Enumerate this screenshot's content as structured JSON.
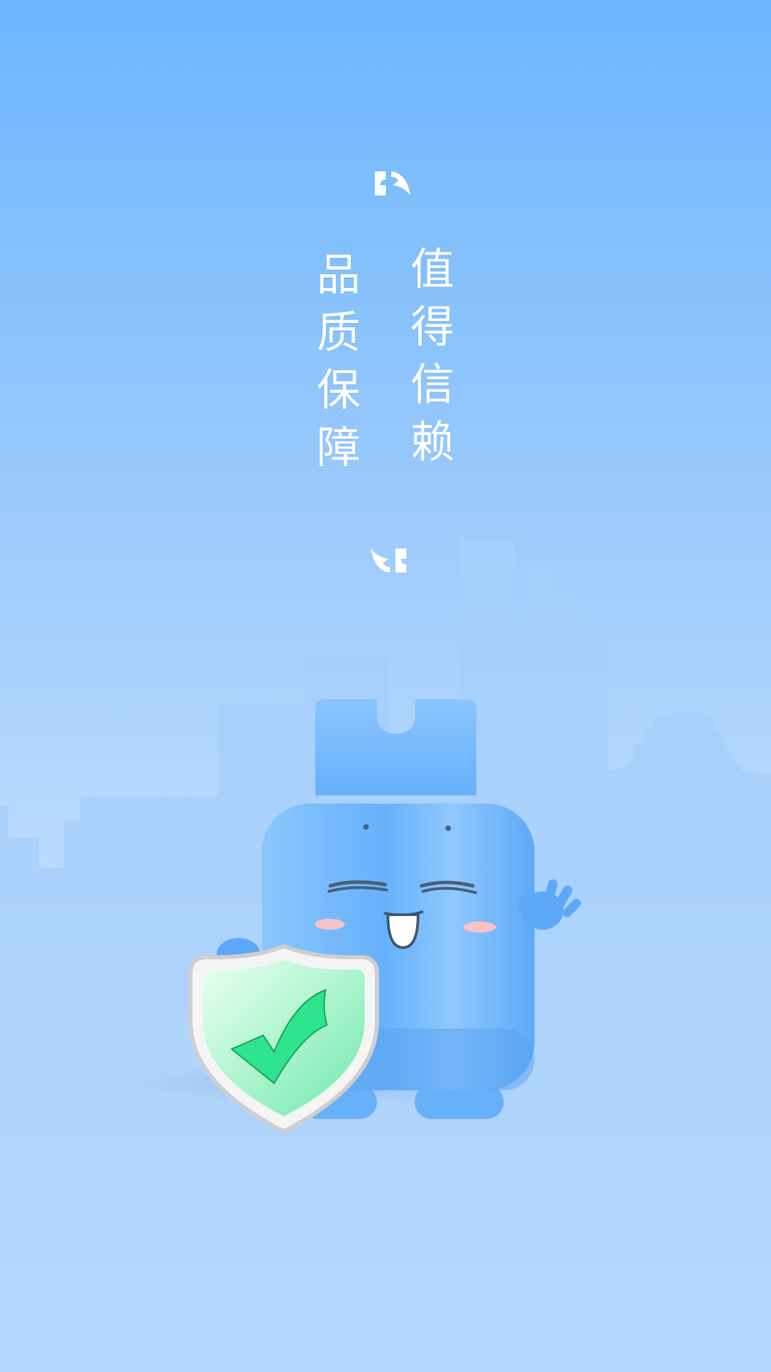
{
  "splash": {
    "slogan_left": [
      "品",
      "质",
      "保",
      "障"
    ],
    "slogan_right": [
      "值",
      "得",
      "信",
      "赖"
    ]
  },
  "icons": {
    "open_quote": "open-quote-icon",
    "close_quote": "close-quote-icon",
    "mascot": "water-jug-mascot-illustration",
    "shield": "check-shield-icon",
    "skyline": "city-skyline-illustration"
  },
  "colors": {
    "background_top": "#6cb6fd",
    "background_bottom": "#dbecfd",
    "skyline": "#a6cffb",
    "mascot_body": "#6fb4fb",
    "shield_check": "#2ee58d",
    "text": "#ffffff"
  }
}
